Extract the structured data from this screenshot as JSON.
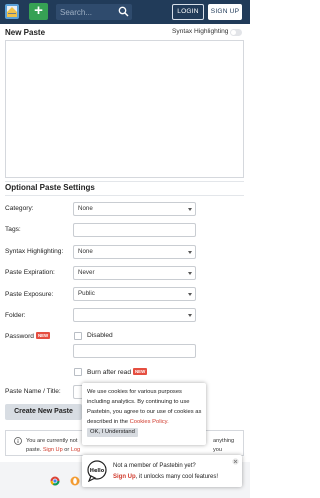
{
  "header": {
    "search_placeholder": "Search...",
    "login_label": "LOGIN",
    "signup_label": "SIGN UP"
  },
  "editor": {
    "title": "New Paste",
    "syntax_highlighting_label": "Syntax Highlighting"
  },
  "settings": {
    "title": "Optional Paste Settings",
    "category": {
      "label": "Category:",
      "value": "None"
    },
    "tags": {
      "label": "Tags:",
      "value": ""
    },
    "syntax": {
      "label": "Syntax Highlighting:",
      "value": "None"
    },
    "expiration": {
      "label": "Paste Expiration:",
      "value": "Never"
    },
    "exposure": {
      "label": "Paste Exposure:",
      "value": "Public"
    },
    "folder": {
      "label": "Folder:",
      "value": ""
    },
    "password": {
      "label": "Password",
      "badge": "NEW",
      "disabled_label": "Disabled",
      "value": ""
    },
    "burn": {
      "label": "Burn after read",
      "badge": "NEW"
    },
    "name": {
      "label": "Paste Name / Title:",
      "value": ""
    },
    "create_label": "Create New Paste"
  },
  "notice": {
    "line1_start": "You are currently not",
    "line1_end": "anything you",
    "line2_start": "paste.",
    "sign_up": "Sign Up",
    "or": "or",
    "log_in_partial": "Log"
  },
  "cookie": {
    "text": "We use cookies for various purposes including analytics. By continuing to use Pastebin, you agree to our use of cookies as described in the",
    "policy_link": "Cookies Policy.",
    "ok_label": "OK, I Understand"
  },
  "member": {
    "hello": "Hello",
    "line1": "Not a member of Pastebin yet?",
    "sign_up": "Sign Up",
    "line2_rest": ", it unlocks many cool features!"
  },
  "colors": {
    "header_bg": "#213b59",
    "add_button": "#36a154",
    "new_badge": "#e54e40",
    "link": "#d03a2c"
  }
}
